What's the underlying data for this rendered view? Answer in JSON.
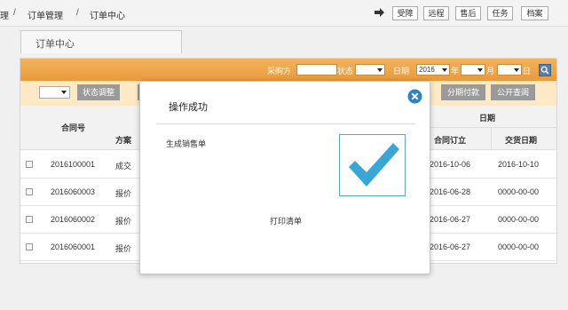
{
  "breadcrumb": {
    "first": "理",
    "sep": "/",
    "second": "订单管理",
    "third": "订单中心"
  },
  "topbar_buttons": [
    "受障",
    "远程",
    "售后",
    "任务",
    "档案"
  ],
  "tab_title": "订单中心",
  "filters": {
    "buyer_label": "采购方",
    "status_label": "状态",
    "date_label": "日期",
    "year_value": "2016",
    "year_label": "年",
    "month_label": "月",
    "day_label": "日"
  },
  "toolbar": {
    "status_adjust": "状态调整",
    "installment": "分期付款",
    "public_query": "公开查阅"
  },
  "table": {
    "headers": {
      "contract_no": "合同号",
      "plan": "方案",
      "date_group": "日期",
      "contract_date": "合同订立",
      "delivery_date": "交货日期"
    },
    "rows": [
      {
        "contract_no": "2016100001",
        "plan": "成交",
        "contract_date": "2016-10-06",
        "delivery_date": "2016-10-10"
      },
      {
        "contract_no": "2016060003",
        "plan": "报价",
        "contract_date": "2016-06-28",
        "delivery_date": "0000-00-00"
      },
      {
        "contract_no": "2016060002",
        "plan": "报价",
        "contract_date": "2016-06-27",
        "delivery_date": "0000-00-00"
      },
      {
        "contract_no": "2016060001",
        "plan": "报价",
        "contract_date": "2016-06-27",
        "delivery_date": "0000-00-00"
      }
    ]
  },
  "modal": {
    "title": "操作成功",
    "message": "生成销售单",
    "print_link": "打印清单"
  },
  "colors": {
    "accent_orange": "#e99a3b",
    "toolbar_bg": "#fde9c6",
    "check_blue": "#3aa6d6",
    "close_blue": "#2f83c5"
  }
}
